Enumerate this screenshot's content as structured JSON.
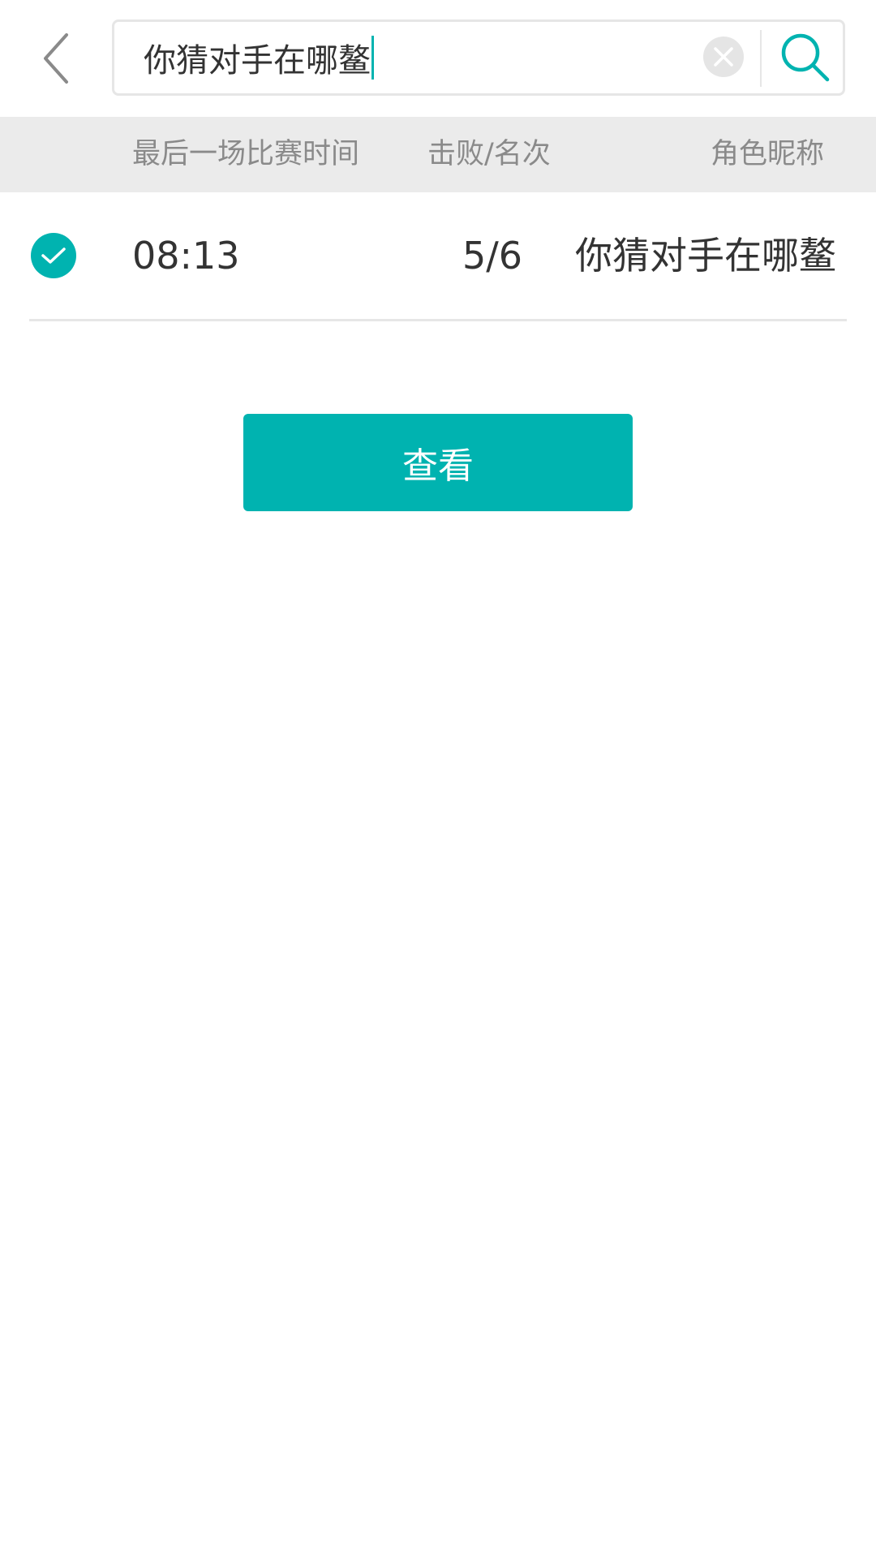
{
  "search": {
    "value": "你猜对手在哪鳌",
    "placeholder": ""
  },
  "table": {
    "headers": [
      "最后一场比赛时间",
      "击败/名次",
      "角色昵称"
    ],
    "rows": [
      {
        "selected": true,
        "time": "08:13",
        "rank": "5/6",
        "nickname": "你猜对手在哪鳌"
      }
    ]
  },
  "actions": {
    "view_label": "查看"
  },
  "colors": {
    "accent": "#00b3b0",
    "header_bg": "#ebebeb",
    "header_text": "#8a8a8a",
    "body_text": "#333333",
    "divider": "#e6e6e6"
  },
  "icons": {
    "back": "chevron-left-icon",
    "clear": "clear-x-icon",
    "search": "search-icon",
    "check": "checkmark-icon"
  }
}
